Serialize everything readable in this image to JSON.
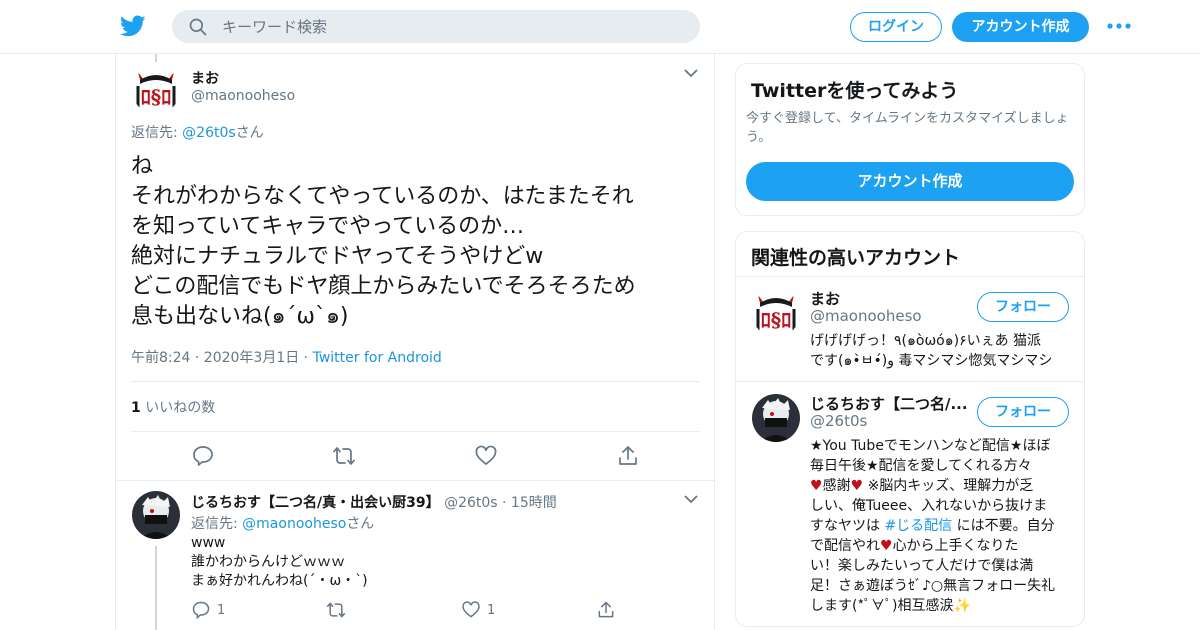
{
  "topbar": {
    "search_placeholder": "キーワード検索",
    "login_label": "ログイン",
    "signup_label": "アカウント作成"
  },
  "colors": {
    "brand": "#1da1f2",
    "link": "#1b95e0",
    "muted": "#657786",
    "heart": "#c0101b"
  },
  "icons": [
    "twitter-logo-icon",
    "search-icon",
    "more-dots-icon",
    "chevron-down-icon",
    "reply-icon",
    "retweet-icon",
    "like-icon",
    "share-icon"
  ],
  "main_tweet": {
    "name": "まお",
    "handle": "@maonooheso",
    "reply_prefix": "返信先: ",
    "reply_to": "@26t0s",
    "reply_suffix": "さん",
    "body_lines": [
      "ね",
      "それがわからなくてやっているのか、はたまたそれ",
      "を知っていてキャラでやっているのか…",
      "絶対にナチュラルでドヤってそうやけどw",
      "どこの配信でもドヤ顔上からみたいでそろそろため",
      "息も出ないね(๑´ω`๑)"
    ],
    "time": "午前8:24 · 2020年3月1日 · ",
    "source": "Twitter for Android",
    "like_count": "1",
    "like_label": " いいねの数"
  },
  "reply_tweet": {
    "name": "じるちおす【二つ名/真・出会い厨39】",
    "handle": "@26t0s",
    "time": " · 15時間",
    "reply_prefix": "返信先: ",
    "reply_to": "@maonooheso",
    "reply_suffix": "さん",
    "body_lines": [
      "www",
      "誰かわからんけどｗｗｗ",
      "まぁ好かれんわね(´・ω・`)"
    ],
    "reply_count": "1",
    "like_count": "1"
  },
  "signup_card": {
    "title": "Twitterを使ってみよう",
    "text": "今すぐ登録して、タイムラインをカスタマイズしましょう。",
    "button": "アカウント作成"
  },
  "related": {
    "title": "関連性の高いアカウント",
    "accounts": [
      {
        "name": "まお",
        "handle": "@maonooheso",
        "follow": "フォロー",
        "bio_lines": [
          "げげげげっ！٩(๑òωó๑)۶いぇあ 猫派",
          "です(๑•̀ㅂ•́)و 毒マシマシ惚気マシマシ"
        ]
      },
      {
        "name": "じるちおす【二つ名/...",
        "handle": "@26t0s",
        "follow": "フォロー",
        "bio_1": "★You Tubeでモンハンなど配信★ほぼ",
        "bio_2": "毎日午後★配信を愛してくれる方々",
        "bio_3a": "感謝",
        "bio_3b": " ※脳内キッズ、理解力が乏",
        "bio_4": "しい、俺Tueee、入れないから抜けま",
        "bio_5a": "すなヤツは ",
        "bio_5b": "#じる配信",
        "bio_5c": " には不要。自分",
        "bio_6a": "で配信やれ",
        "bio_6b": "心から上手くなりた",
        "bio_7": "い！楽しみたいって人だけで僕は満",
        "bio_8": "足！さぁ遊ぼうｾﾞ♪○無言フォロー失礼",
        "bio_9": "します(*ﾟ∀ﾟ)相互感涙",
        "heart_emoji": "♥",
        "sparkle_emoji": "✨"
      }
    ]
  }
}
